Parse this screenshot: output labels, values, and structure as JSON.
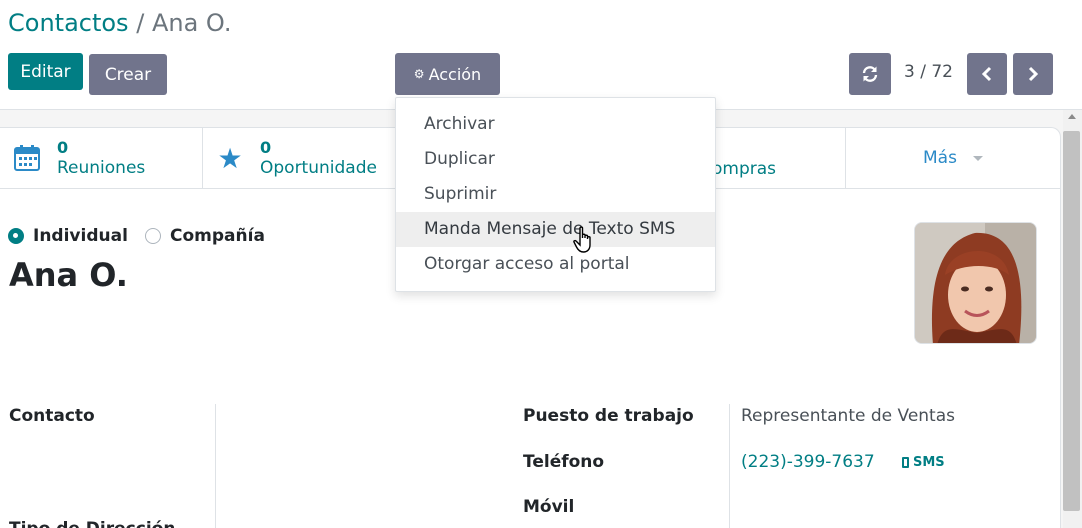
{
  "breadcrumb": {
    "parent": "Contactos",
    "separator": "/",
    "current": "Ana O."
  },
  "toolbar": {
    "edit_label": "Editar",
    "create_label": "Crear",
    "action_label": "Acción",
    "action_icon": "gear-icon",
    "refresh_icon": "refresh-icon"
  },
  "pager": {
    "value": "3 / 72",
    "prev_icon": "chevron-left-icon",
    "next_icon": "chevron-right-icon"
  },
  "action_menu": {
    "items": [
      {
        "label": "Archivar"
      },
      {
        "label": "Duplicar"
      },
      {
        "label": "Suprimir"
      },
      {
        "label": "Manda Mensaje de Texto SMS"
      },
      {
        "label": "Otorgar acceso al portal"
      }
    ],
    "hovered_index": 3
  },
  "smart_buttons": [
    {
      "count": "0",
      "label": "Reuniones",
      "icon": "calendar-icon"
    },
    {
      "count": "0",
      "label": "Oportunidade",
      "icon": "star-icon"
    },
    {
      "label": "ompras"
    }
  ],
  "smart_more": {
    "label": "Más"
  },
  "partner_type": {
    "individual_label": "Individual",
    "company_label": "Compañía",
    "selected": "individual"
  },
  "partner": {
    "name": "Ana O."
  },
  "fields": {
    "contact_label": "Contacto",
    "address_label": "Tipo de Dirección",
    "job_label": "Puesto de trabajo",
    "job_value": "Representante de Ventas",
    "phone_label": "Teléfono",
    "phone_value": "(223)-399-7637",
    "sms_label": "SMS",
    "mobile_label": "Móvil"
  },
  "colors": {
    "primary": "#017e84",
    "secondary": "#71748c",
    "link": "#2b8ac7"
  }
}
